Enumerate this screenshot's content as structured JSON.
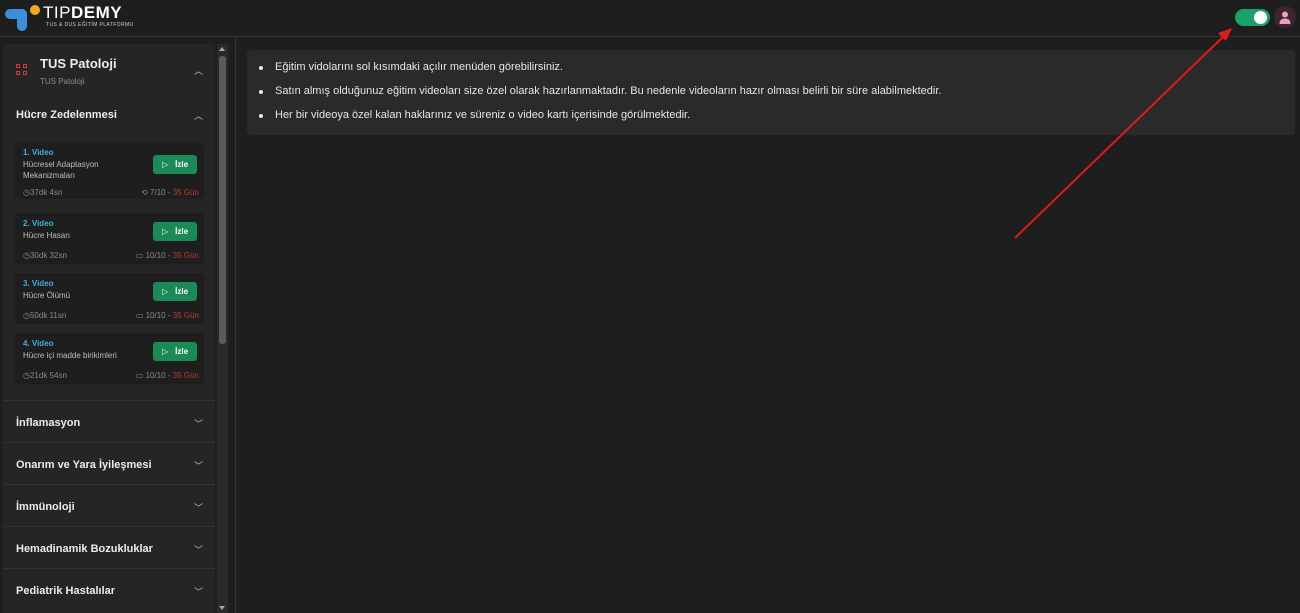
{
  "header": {
    "brand_left": "TIP",
    "brand_right": "DEMY",
    "brand_tagline": "TUS & DUS EĞİTİM PLATFORMU"
  },
  "colors": {
    "accent_green": "#1b8a57",
    "accent_blue": "#3fb0e0",
    "danger_red": "#c0392b",
    "toggle_on": "#1aa06a"
  },
  "sidebar": {
    "course": {
      "title": "TUS Patoloji",
      "subtitle": "TUS Patoloji"
    },
    "open_section": {
      "title": "Hücre Zedelenmesi",
      "videos": [
        {
          "num": "1. Video",
          "name": "Hücresel Adaptasyon Mekanizmaları",
          "duration": "37dk 4sn",
          "count": "7/10 -",
          "days": "35 Gün",
          "watch_label": "İzle"
        },
        {
          "num": "2. Video",
          "name": "Hücre Hasarı",
          "duration": "30dk 32sn",
          "count": "10/10 -",
          "days": "35 Gün",
          "watch_label": "İzle"
        },
        {
          "num": "3. Video",
          "name": "Hücre Ölümü",
          "duration": "50dk 11sn",
          "count": "10/10 -",
          "days": "35 Gün",
          "watch_label": "İzle"
        },
        {
          "num": "4. Video",
          "name": "Hücre içi madde birikimleri",
          "duration": "21dk 54sn",
          "count": "10/10 -",
          "days": "35 Gün",
          "watch_label": "İzle"
        }
      ]
    },
    "sections": [
      "İnflamasyon",
      "Onarım ve Yara İyileşmesi",
      "İmmünoloji",
      "Hemadinamik Bozukluklar",
      "Pediatrik Hastalılar"
    ]
  },
  "info": {
    "items": [
      "Eğitim vidolarını sol kısımdaki açılır menüden görebilirsiniz.",
      "Satın almış olduğunuz eğitim videoları size özel olarak hazırlanmaktadır. Bu nedenle videoların hazır olması belirli bir süre alabilmektedir.",
      "Her bir videoya özel kalan haklarınız ve süreniz o video kartı içerisinde görülmektedir."
    ]
  }
}
